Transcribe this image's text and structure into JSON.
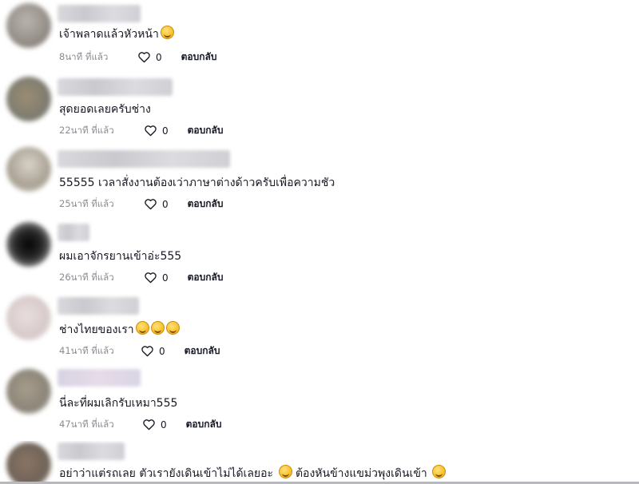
{
  "icons": {
    "like": "heart-outline-icon",
    "emoji": "laughing-emoji-icon"
  },
  "colors": {
    "text": "#161823",
    "meta": "#8a8b91"
  },
  "comments": [
    {
      "text": "เจ้าพลาดแล้วหัวหน้า",
      "time": "8นาที ที่แล้ว",
      "likes": "0",
      "reply": "ตอบกลับ"
    },
    {
      "text": "สุดยอดเลยครับช่าง",
      "time": "22นาที ที่แล้ว",
      "likes": "0",
      "reply": "ตอบกลับ"
    },
    {
      "text": "55555 เวลาสั่งงานต้องเว่าภาษาต่างด้าวครับเพื่อความชัว",
      "time": "25นาที ที่แล้ว",
      "likes": "0",
      "reply": "ตอบกลับ"
    },
    {
      "text": "ผมเอาจักรยานเข้าอ่ะ555",
      "time": "26นาที ที่แล้ว",
      "likes": "0",
      "reply": "ตอบกลับ"
    },
    {
      "text": "ช่างไทยของเรา",
      "time": "41นาที ที่แล้ว",
      "likes": "0",
      "reply": "ตอบกลับ"
    },
    {
      "text": "นี่ละที่ผมเลิกรับเหมา555",
      "time": "47นาที ที่แล้ว",
      "likes": "0",
      "reply": "ตอบกลับ"
    },
    {
      "text_a": "อย่าว่าแต่รถเลย ตัวเรายังเดินเข้าไม่ได้เลยอะ",
      "text_b": "ต้องหันข้างแขม่วพุงเดินเข้า"
    }
  ]
}
